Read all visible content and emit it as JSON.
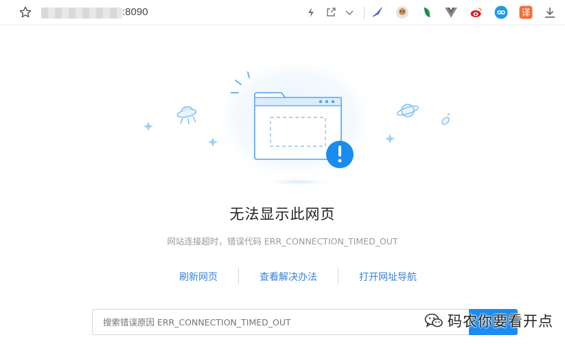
{
  "browser": {
    "url_port": ":8090"
  },
  "error_page": {
    "title": "无法显示此网页",
    "message": "网站连接超时，错误代码 ERR_CONNECTION_TIMED_OUT",
    "links": {
      "refresh": "刷新网页",
      "solutions": "查看解决办法",
      "navigation": "打开网址导航"
    },
    "search": {
      "placeholder": "搜索错误原因 ERR_CONNECTION_TIMED_OUT"
    }
  },
  "watermark": {
    "text": "码农你要看开点"
  },
  "colors": {
    "accent": "#1a8cf0",
    "link": "#3a82d6",
    "illustration_line": "#4da3ee"
  }
}
